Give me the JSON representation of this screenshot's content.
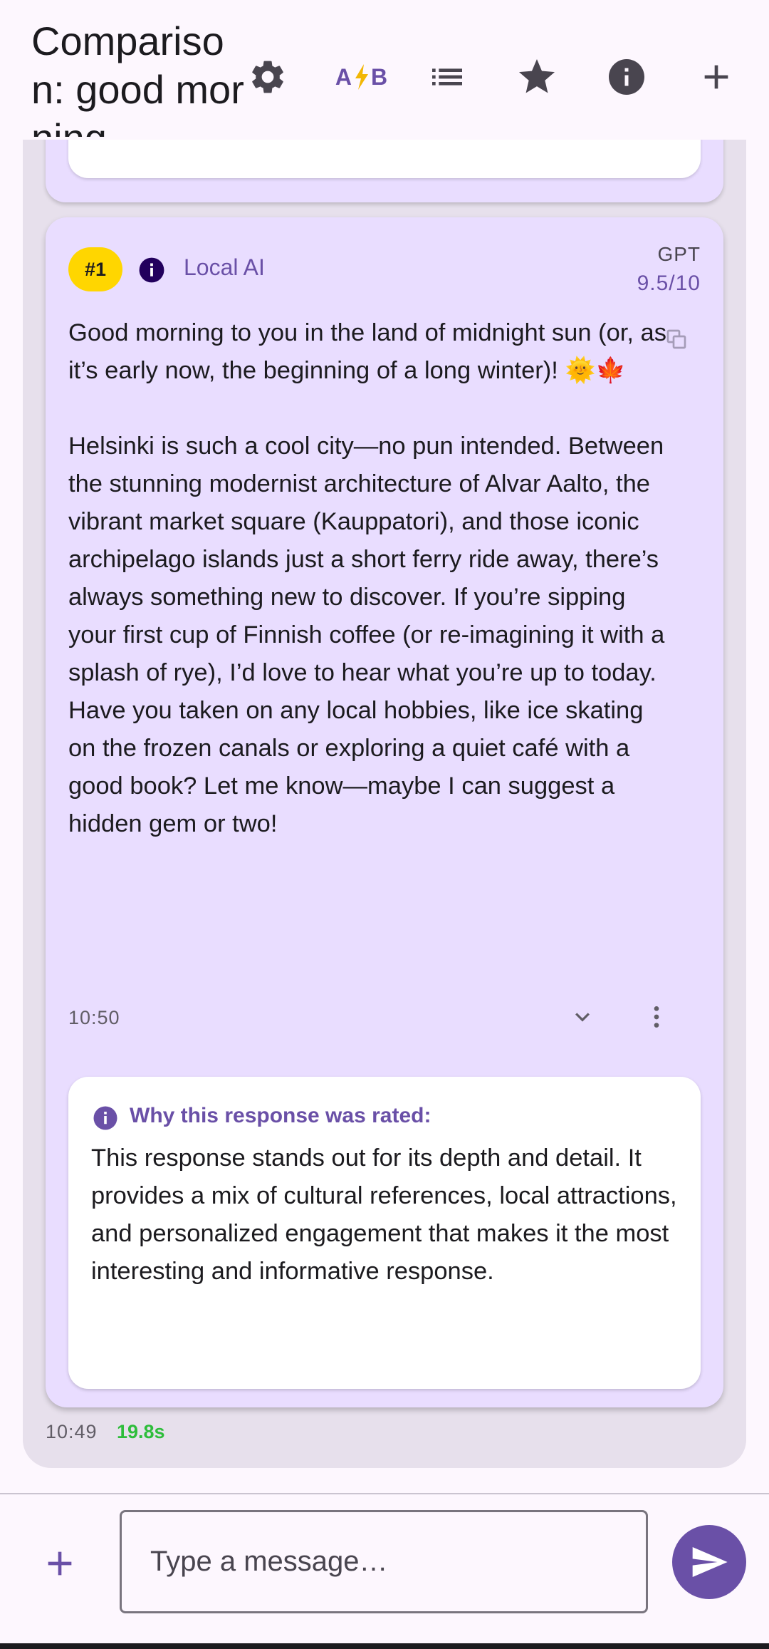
{
  "appbar": {
    "title": "Comparison: good morning",
    "ab_label_a": "A",
    "ab_label_b": "B",
    "icons": [
      "gear-icon",
      "ab-compare-icon",
      "list-icon",
      "star-icon",
      "info-icon",
      "plus-icon"
    ]
  },
  "response": {
    "rank": "#1",
    "provider": "Local AI",
    "model": "GPT",
    "score": "9.5/10",
    "paragraphs": [
      "Good morning to you in the land of midnight sun (or, as it’s early now, the beginning of a long winter)! 🌞🍁",
      "Helsinki is such a cool city—no pun intended. Between the stunning modernist architecture of Alvar Aalto, the vibrant market square (Kauppatori), and those iconic archipelago islands just a short ferry ride away, there’s always something new to discover. If you’re sipping your first cup of Finnish coffee (or re-imagining it with a splash of rye), I’d love to hear what you’re up to today. Have you taken on any local hobbies, like ice skating on the frozen canals or exploring a quiet café with a good book? Let me know—maybe I can suggest a hidden gem or two!"
    ],
    "time": "10:50",
    "why_title": "Why this response was rated:",
    "why_body": "This response stands out for its depth and detail. It provides a mix of cultural references, local attractions, and personalized engagement that makes it the most interesting and informative response."
  },
  "footer": {
    "time": "10:49",
    "duration": "19.8s"
  },
  "composer": {
    "placeholder": "Type a message…"
  },
  "colors": {
    "accent": "#6a50a7",
    "rank_badge": "#ffd600",
    "card": "#e9ddff",
    "duration": "#2ebd3b"
  }
}
